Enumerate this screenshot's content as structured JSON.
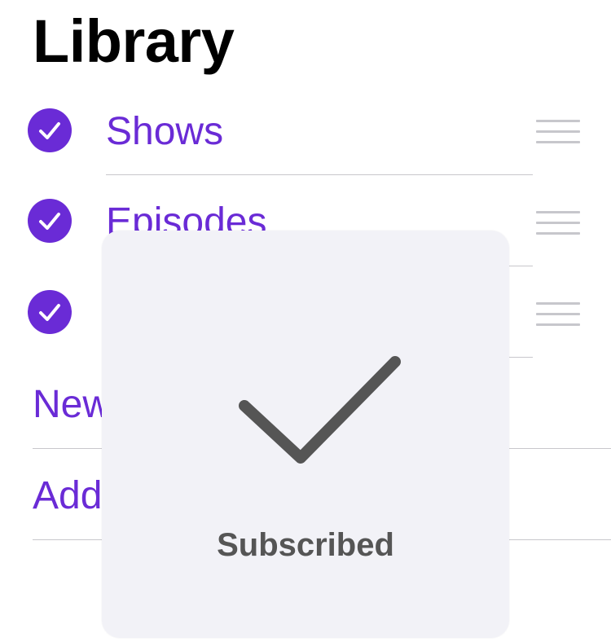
{
  "header": {
    "title": "Library"
  },
  "library": {
    "items": [
      {
        "label": "Shows",
        "checked": true
      },
      {
        "label": "Episodes",
        "checked": true
      },
      {
        "label": "",
        "checked": true
      }
    ]
  },
  "actions": {
    "new_label": "New",
    "add_label": "Add"
  },
  "hud": {
    "label": "Subscribed",
    "icon": "checkmark-icon"
  },
  "colors": {
    "accent": "#6a2bd6",
    "hud_background": "#f2f2f7",
    "hud_foreground": "#555555",
    "separator": "#c8c7cc",
    "handle": "#c7c7cc"
  }
}
